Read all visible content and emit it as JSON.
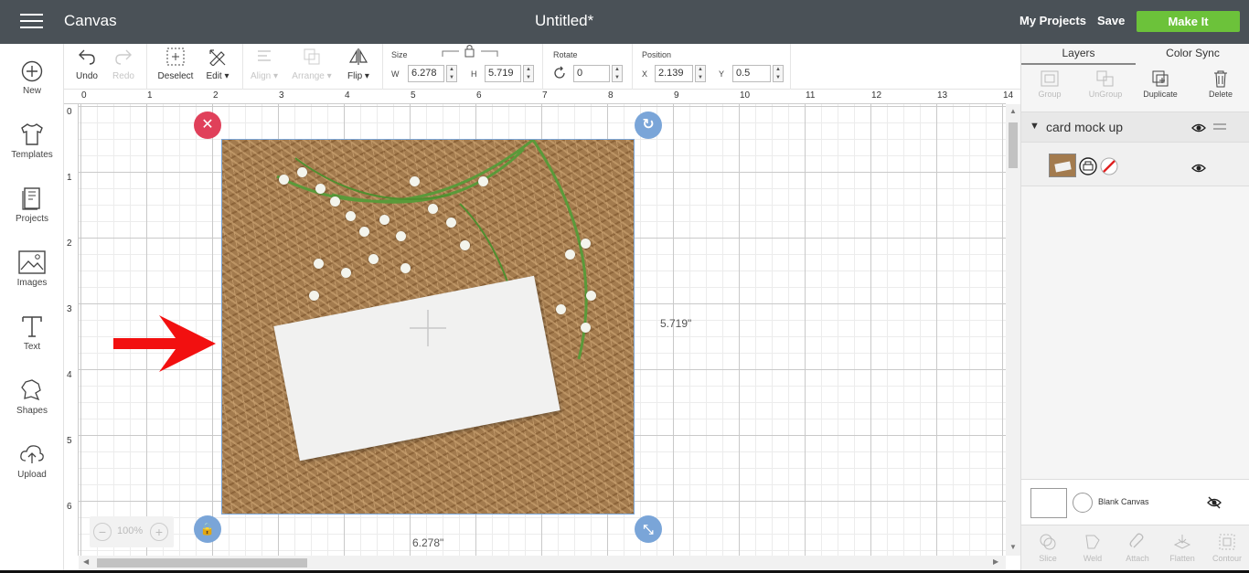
{
  "topbar": {
    "app_title": "Canvas",
    "doc_title": "Untitled*",
    "my_projects": "My Projects",
    "save": "Save",
    "make_it": "Make It"
  },
  "leftbar": {
    "items": [
      {
        "label": "New",
        "icon": "plus-circle-icon"
      },
      {
        "label": "Templates",
        "icon": "shirt-icon"
      },
      {
        "label": "Projects",
        "icon": "projects-icon"
      },
      {
        "label": "Images",
        "icon": "image-icon"
      },
      {
        "label": "Text",
        "icon": "text-icon"
      },
      {
        "label": "Shapes",
        "icon": "shapes-icon"
      },
      {
        "label": "Upload",
        "icon": "upload-icon"
      }
    ]
  },
  "toolbar": {
    "undo": "Undo",
    "redo": "Redo",
    "deselect": "Deselect",
    "edit": "Edit",
    "align": "Align",
    "arrange": "Arrange",
    "flip": "Flip",
    "size_label": "Size",
    "w_label": "W",
    "w_value": "6.278",
    "h_label": "H",
    "h_value": "5.719",
    "rotate_label": "Rotate",
    "rotate_value": "0",
    "position_label": "Position",
    "x_label": "X",
    "x_value": "2.139",
    "y_label": "Y",
    "y_value": "0.5"
  },
  "rulers": {
    "top": [
      "0",
      "1",
      "2",
      "3",
      "4",
      "5",
      "6",
      "7",
      "8",
      "9",
      "10",
      "11",
      "12",
      "13",
      "14"
    ],
    "left": [
      "0",
      "1",
      "2",
      "3",
      "4",
      "5",
      "6"
    ]
  },
  "canvas": {
    "height_label": "5.719\"",
    "width_label": "6.278\"",
    "zoom": "100%",
    "annotation_color": "#f21010"
  },
  "rpanel": {
    "tab_layers": "Layers",
    "tab_color_sync": "Color Sync",
    "actions": {
      "group": "Group",
      "ungroup": "UnGroup",
      "duplicate": "Duplicate",
      "delete": "Delete"
    },
    "group_name": "card mock up",
    "blank_canvas": "Blank Canvas",
    "bottom": {
      "slice": "Slice",
      "weld": "Weld",
      "attach": "Attach",
      "flatten": "Flatten",
      "contour": "Contour"
    }
  },
  "colors": {
    "topbar": "#4a5157",
    "make_it": "#6cc23a",
    "delete_handle": "#e0405a",
    "handle_blue": "#7aa5d8"
  }
}
